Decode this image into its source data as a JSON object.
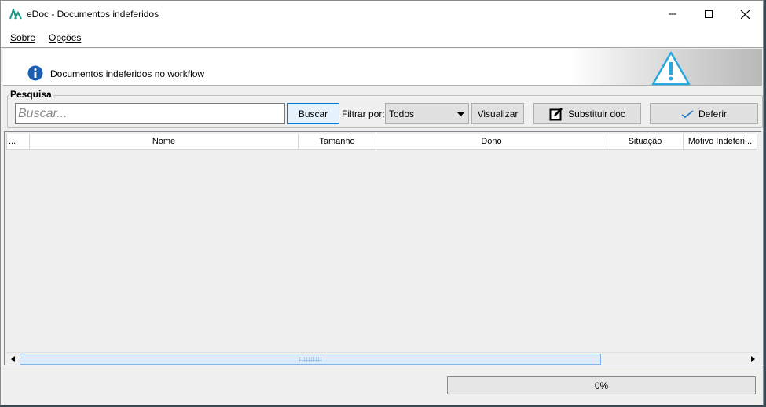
{
  "window": {
    "title": "eDoc - Documentos indeferidos"
  },
  "menu": {
    "items": [
      "Sobre",
      "Opções"
    ]
  },
  "banner": {
    "text": "Documentos indeferidos no workflow"
  },
  "search": {
    "group_label": "Pesquisa",
    "placeholder": "Buscar...",
    "value": "",
    "search_button": "Buscar",
    "filter_label": "Filtrar por:",
    "filter_value": "Todos",
    "view_button": "Visualizar",
    "replace_button": "Substituir doc",
    "approve_button": "Deferir"
  },
  "grid": {
    "columns": [
      "...",
      "Nome",
      "Tamanho",
      "Dono",
      "Situação",
      "Motivo Indeferi..."
    ],
    "rows": []
  },
  "status": {
    "progress_text": "0%",
    "progress_value": 0
  },
  "colors": {
    "accent": "#0078d7",
    "info": "#1a5fb4",
    "warning": "#29a8e0"
  }
}
